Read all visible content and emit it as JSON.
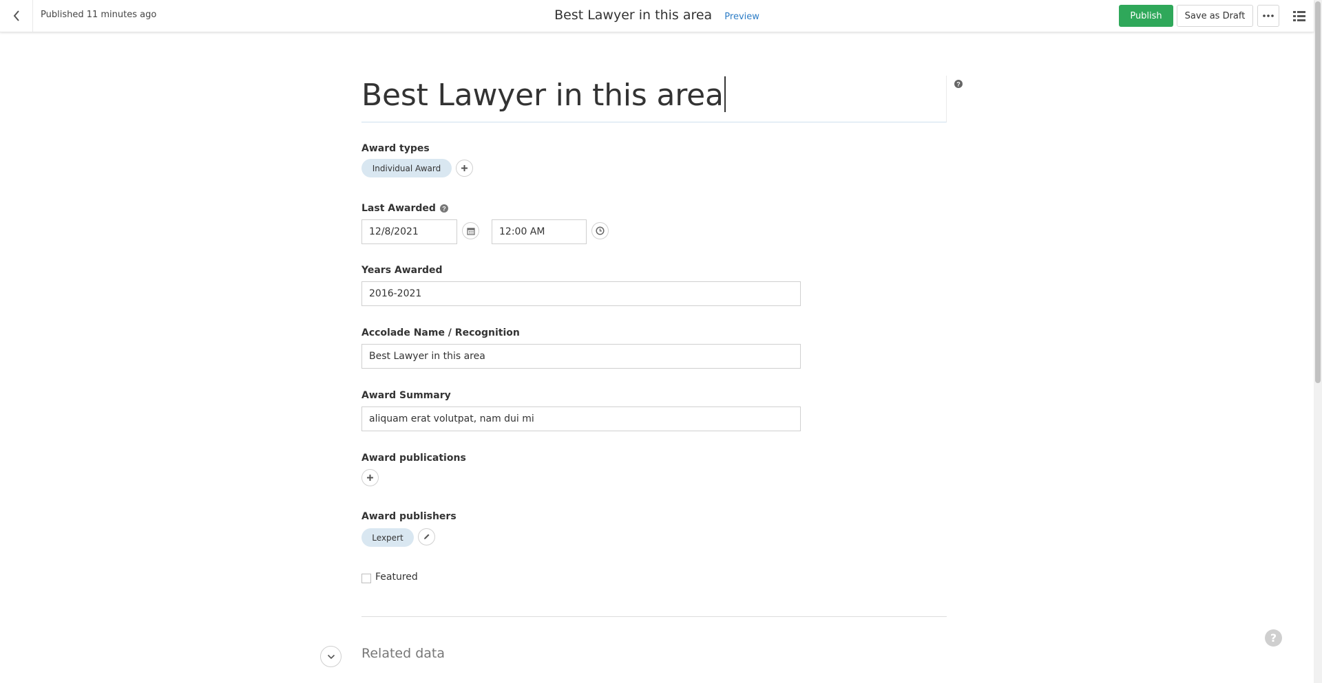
{
  "topbar": {
    "status": "Published 11 minutes ago",
    "title": "Best Lawyer in this area",
    "preview_label": "Preview",
    "publish_label": "Publish",
    "save_draft_label": "Save as Draft"
  },
  "form": {
    "title_value": "Best Lawyer in this area",
    "award_types": {
      "label": "Award types",
      "tags": [
        "Individual Award"
      ]
    },
    "last_awarded": {
      "label": "Last Awarded",
      "date": "12/8/2021",
      "time": "12:00 AM"
    },
    "years_awarded": {
      "label": "Years Awarded",
      "value": "2016-2021"
    },
    "accolade_name": {
      "label": "Accolade Name / Recognition",
      "value": "Best Lawyer in this area"
    },
    "award_summary": {
      "label": "Award Summary",
      "value": "aliquam erat volutpat, nam dui mi"
    },
    "award_publications": {
      "label": "Award publications"
    },
    "award_publishers": {
      "label": "Award publishers",
      "tags": [
        "Lexpert"
      ]
    },
    "featured": {
      "label": "Featured",
      "checked": false
    }
  },
  "related": {
    "title": "Related data"
  },
  "colors": {
    "publish": "#2fa85a",
    "tag_bg": "#d9e7f1",
    "link": "#2d7dc6"
  },
  "icons": [
    "back-arrow-icon",
    "more-icon",
    "list-icon",
    "help-icon",
    "plus-icon",
    "calendar-icon",
    "clock-icon",
    "pencil-icon",
    "chevron-down-icon"
  ]
}
